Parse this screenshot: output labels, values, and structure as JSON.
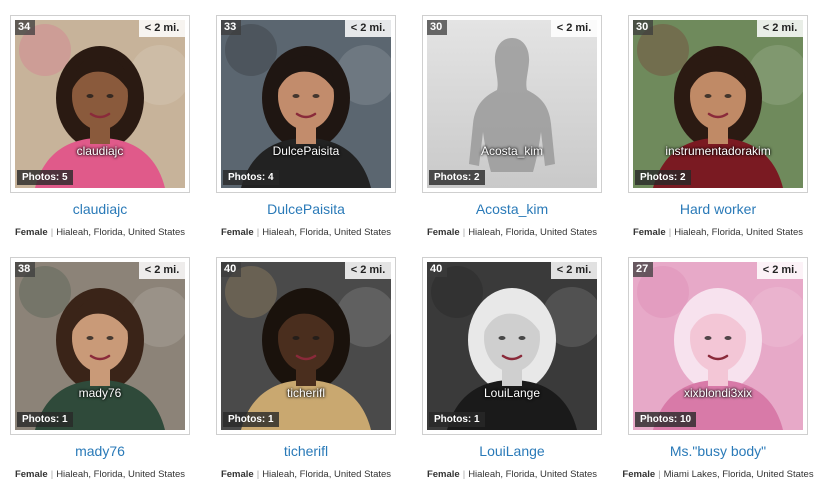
{
  "profiles": [
    {
      "age": "34",
      "distance": "< 2 mi.",
      "username": "claudiajc",
      "photos": "Photos: 5",
      "headline": "claudiajc",
      "gender": "Female",
      "location": "Hialeah, Florida, United States",
      "bg": "#c7b39a",
      "skin": "#8a5a3c",
      "hair": "#2a1a12",
      "accent": "#e05a8a"
    },
    {
      "age": "33",
      "distance": "< 2 mi.",
      "username": "DulcePaisita",
      "photos": "Photos: 4",
      "headline": "DulcePaisita",
      "gender": "Female",
      "location": "Hialeah, Florida, United States",
      "bg": "#5b6670",
      "skin": "#c28c6c",
      "hair": "#1f1612",
      "accent": "#222222"
    },
    {
      "age": "30",
      "distance": "< 2 mi.",
      "username": "Acosta_kim",
      "photos": "Photos: 2",
      "headline": "Acosta_kim",
      "gender": "Female",
      "location": "Hialeah, Florida, United States",
      "bg": "#d9d9d9",
      "skin": "#9a9a9a",
      "hair": "#9a9a9a",
      "accent": "#bdbdbd"
    },
    {
      "age": "30",
      "distance": "< 2 mi.",
      "username": "instrumentadorakim",
      "photos": "Photos: 2",
      "headline": "Hard worker",
      "gender": "Female",
      "location": "Hialeah, Florida, United States",
      "bg": "#6f8a5c",
      "skin": "#c08a66",
      "hair": "#2b1a12",
      "accent": "#7a1a22"
    },
    {
      "age": "38",
      "distance": "< 2 mi.",
      "username": "mady76",
      "photos": "Photos: 1",
      "headline": "mady76",
      "gender": "Female",
      "location": "Hialeah, Florida, United States",
      "bg": "#8c8378",
      "skin": "#c99a78",
      "hair": "#3a2418",
      "accent": "#2f4a3a"
    },
    {
      "age": "40",
      "distance": "< 2 mi.",
      "username": "ticherifl",
      "photos": "Photos: 1",
      "headline": "ticherifl",
      "gender": "Female",
      "location": "Hialeah, Florida, United States",
      "bg": "#4a4a4a",
      "skin": "#4a2e1e",
      "hair": "#1a120c",
      "accent": "#c9a870"
    },
    {
      "age": "40",
      "distance": "< 2 mi.",
      "username": "LouiLange",
      "photos": "Photos: 1",
      "headline": "LouiLange",
      "gender": "Female",
      "location": "Hialeah, Florida, United States",
      "bg": "#3a3a3a",
      "skin": "#cfcfcf",
      "hair": "#e8e8e8",
      "accent": "#1a1a1a"
    },
    {
      "age": "27",
      "distance": "< 2 mi.",
      "username": "xixblondi3xix",
      "photos": "Photos: 10",
      "headline": "Ms.\"busy body\"",
      "gender": "Female",
      "location": "Miami Lakes, Florida, United States",
      "bg": "#e7a9c8",
      "skin": "#f3c6d6",
      "hair": "#f7e2ee",
      "accent": "#d87aa8"
    }
  ]
}
